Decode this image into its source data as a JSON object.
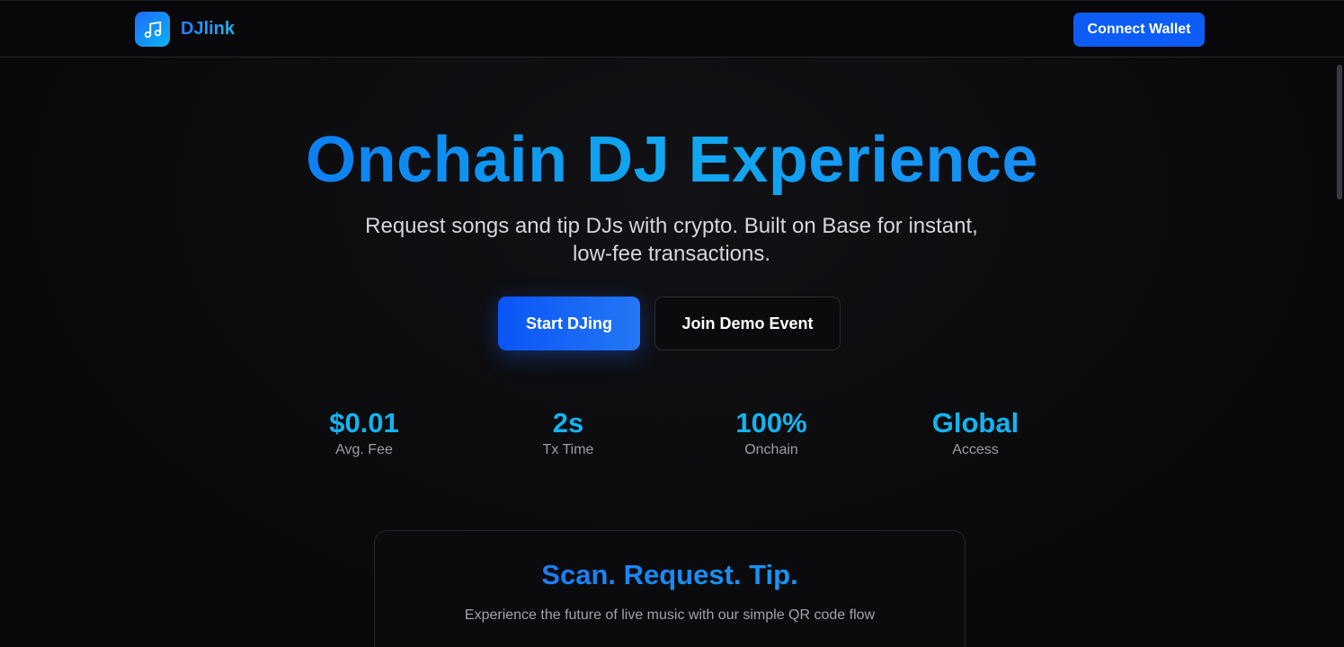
{
  "navbar": {
    "brand_name": "DJlink",
    "logo_icon": "music-note-icon",
    "connect_label": "Connect Wallet"
  },
  "hero": {
    "title": "Onchain DJ Experience",
    "subtitle": "Request songs and tip DJs with crypto. Built on Base for instant, low-fee transactions.",
    "primary_cta": "Start DJing",
    "secondary_cta": "Join Demo Event"
  },
  "stats": [
    {
      "value": "$0.01",
      "label": "Avg. Fee"
    },
    {
      "value": "2s",
      "label": "Tx Time"
    },
    {
      "value": "100%",
      "label": "Onchain"
    },
    {
      "value": "Global",
      "label": "Access"
    }
  ],
  "feature_card": {
    "title": "Scan. Request. Tip.",
    "subtitle": "Experience the future of live music with our simple QR code flow"
  },
  "colors": {
    "accent": "#0d5cf5",
    "accent_cyan": "#13b4f0",
    "background": "#0a0a0c"
  }
}
